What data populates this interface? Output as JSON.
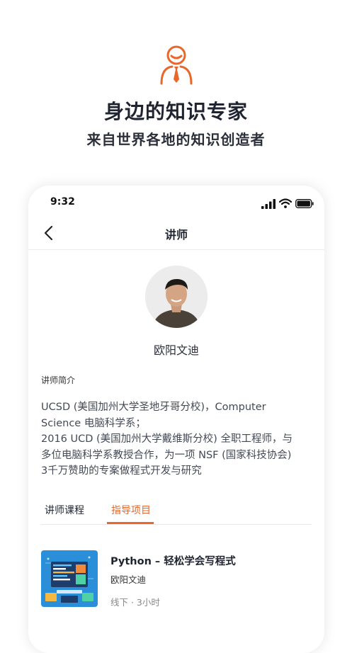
{
  "hero": {
    "title": "身边的知识专家",
    "subtitle": "来自世界各地的知识创造者",
    "icon": "person-with-tie-icon",
    "accent_color": "#e8672b"
  },
  "status_bar": {
    "time": "9:32",
    "icons": [
      "signal-icon",
      "wifi-icon",
      "battery-icon"
    ]
  },
  "nav": {
    "back_icon": "chevron-left-icon",
    "title": "讲师"
  },
  "profile": {
    "name": "欧阳文迪",
    "intro_label": "讲师简介",
    "bio_lines": [
      "UCSD (美国加州大学圣地牙哥分校)，Computer",
      "Science 电脑科学系；",
      "2016 UCD (美国加州大学戴维斯分校) 全职工程师，与",
      "多位电脑科学系教授合作，为一项 NSF (国家科技协会)",
      "3千万赞助的专案做程式开发与研究"
    ]
  },
  "tabs": [
    {
      "label": "讲师课程",
      "active": false
    },
    {
      "label": "指导项目",
      "active": true
    }
  ],
  "courses": [
    {
      "title": "Python – 轻松学会写程式",
      "teacher": "欧阳文迪",
      "meta": "线下 · 3小时"
    }
  ]
}
